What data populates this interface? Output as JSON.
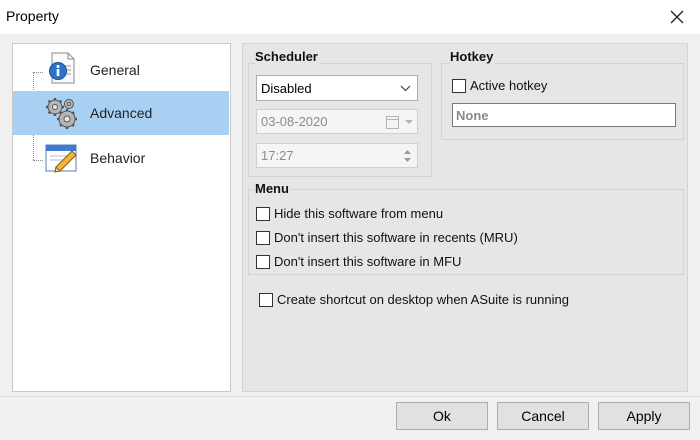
{
  "window": {
    "title": "Property"
  },
  "tree": {
    "items": [
      {
        "label": "General",
        "icon": "info-page-icon"
      },
      {
        "label": "Advanced",
        "icon": "gears-icon"
      },
      {
        "label": "Behavior",
        "icon": "window-pencil-icon"
      }
    ],
    "selected_index": 1
  },
  "scheduler": {
    "title": "Scheduler",
    "mode": "Disabled",
    "date": "03-08-2020",
    "time": "17:27"
  },
  "hotkey": {
    "title": "Hotkey",
    "active_label": "Active hotkey",
    "value": "None"
  },
  "menu": {
    "title": "Menu",
    "options": [
      "Hide this software from menu",
      "Don't insert this software in recents (MRU)",
      "Don't insert this software in MFU"
    ]
  },
  "shortcut_label": "Create shortcut on desktop when ASuite is running",
  "buttons": {
    "ok": "Ok",
    "cancel": "Cancel",
    "apply": "Apply"
  },
  "colors": {
    "selection": "#a7d0f2",
    "panel": "#e6e6e6",
    "window": "#f0f0f0"
  }
}
